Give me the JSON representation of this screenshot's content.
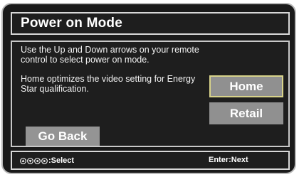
{
  "title": "Power on Mode",
  "instruction": "Use the Up and Down arrows on your remote control to select power on mode.",
  "description": "Home optimizes the video setting for Energy Star qualification.",
  "options": [
    {
      "label": "Home",
      "selected": true
    },
    {
      "label": "Retail",
      "selected": false
    }
  ],
  "go_back_label": "Go Back",
  "footer": {
    "select_icons": [
      "up-arrow-icon",
      "down-arrow-icon",
      "left-arrow-icon",
      "right-arrow-icon"
    ],
    "select_label": ":Select",
    "next_label": "Enter:Next"
  },
  "colors": {
    "background": "#1e1e1e",
    "button": "#909090",
    "selected_border": "#d8d38a",
    "frame_border": "#d8d8d8"
  }
}
